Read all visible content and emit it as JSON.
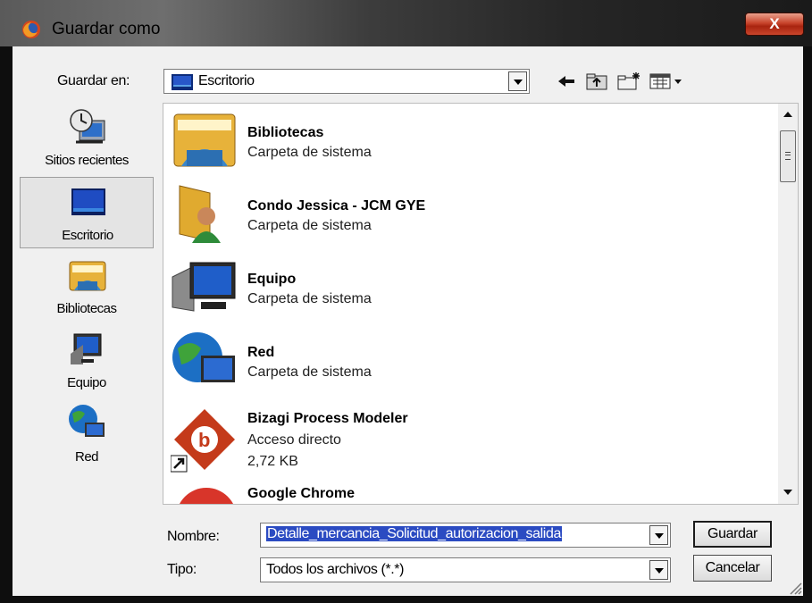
{
  "window": {
    "title": "Guardar como",
    "close_label": "X"
  },
  "save_in": {
    "label": "Guardar en:",
    "value": "Escritorio"
  },
  "toolbar": {
    "back_icon": "back-arrow-icon",
    "up_icon": "up-folder-icon",
    "new_folder_icon": "new-folder-icon",
    "view_icon": "view-menu-icon"
  },
  "sidebar": {
    "items": [
      {
        "label": "Sitios recientes",
        "icon": "recent-places-icon"
      },
      {
        "label": "Escritorio",
        "icon": "desktop-icon",
        "selected": true
      },
      {
        "label": "Bibliotecas",
        "icon": "libraries-icon"
      },
      {
        "label": "Equipo",
        "icon": "computer-icon"
      },
      {
        "label": "Red",
        "icon": "network-icon"
      }
    ]
  },
  "files": [
    {
      "name": "Bibliotecas",
      "type": "Carpeta de sistema",
      "icon": "libraries-icon"
    },
    {
      "name": "Condo Jessica - JCM GYE",
      "type": "Carpeta de sistema",
      "icon": "user-folder-icon"
    },
    {
      "name": "Equipo",
      "type": "Carpeta de sistema",
      "icon": "computer-icon"
    },
    {
      "name": "Red",
      "type": "Carpeta de sistema",
      "icon": "network-icon"
    },
    {
      "name": "Bizagi Process Modeler",
      "type": "Acceso directo",
      "size": "2,72 KB",
      "icon": "bizagi-shortcut-icon"
    },
    {
      "name": "Google Chrome",
      "icon": "chrome-icon"
    }
  ],
  "filename": {
    "label": "Nombre:",
    "value": "Detalle_mercancia_Solicitud_autorizacion_salida"
  },
  "filetype": {
    "label": "Tipo:",
    "value": "Todos los archivos (*.*)"
  },
  "buttons": {
    "save": "Guardar",
    "cancel": "Cancelar"
  }
}
